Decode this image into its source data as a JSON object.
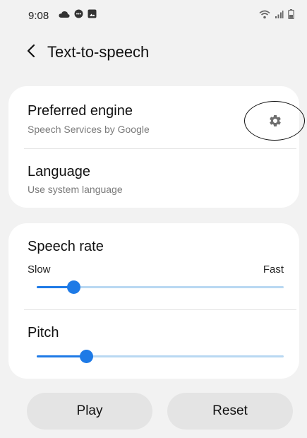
{
  "status_bar": {
    "time": "9:08",
    "left_icons": [
      "cloud-icon",
      "chat-bubble-icon",
      "gallery-icon"
    ],
    "right_icons": [
      "wifi-icon",
      "signal-icon",
      "battery-icon"
    ]
  },
  "header": {
    "title": "Text-to-speech"
  },
  "engine_card": {
    "preferred_engine": {
      "title": "Preferred engine",
      "subtitle": "Speech Services by Google"
    },
    "language": {
      "title": "Language",
      "subtitle": "Use system language"
    }
  },
  "speech_card": {
    "speech_rate": {
      "title": "Speech rate",
      "min_label": "Slow",
      "max_label": "Fast",
      "value_fraction": 0.15
    },
    "pitch": {
      "title": "Pitch",
      "value_fraction": 0.2
    }
  },
  "buttons": {
    "play": "Play",
    "reset": "Reset"
  },
  "colors": {
    "accent": "#1e7ae6",
    "track_inactive": "#b9d8f2",
    "background": "#f2f2f2",
    "card": "#ffffff",
    "button_bg": "#e4e4e4"
  }
}
